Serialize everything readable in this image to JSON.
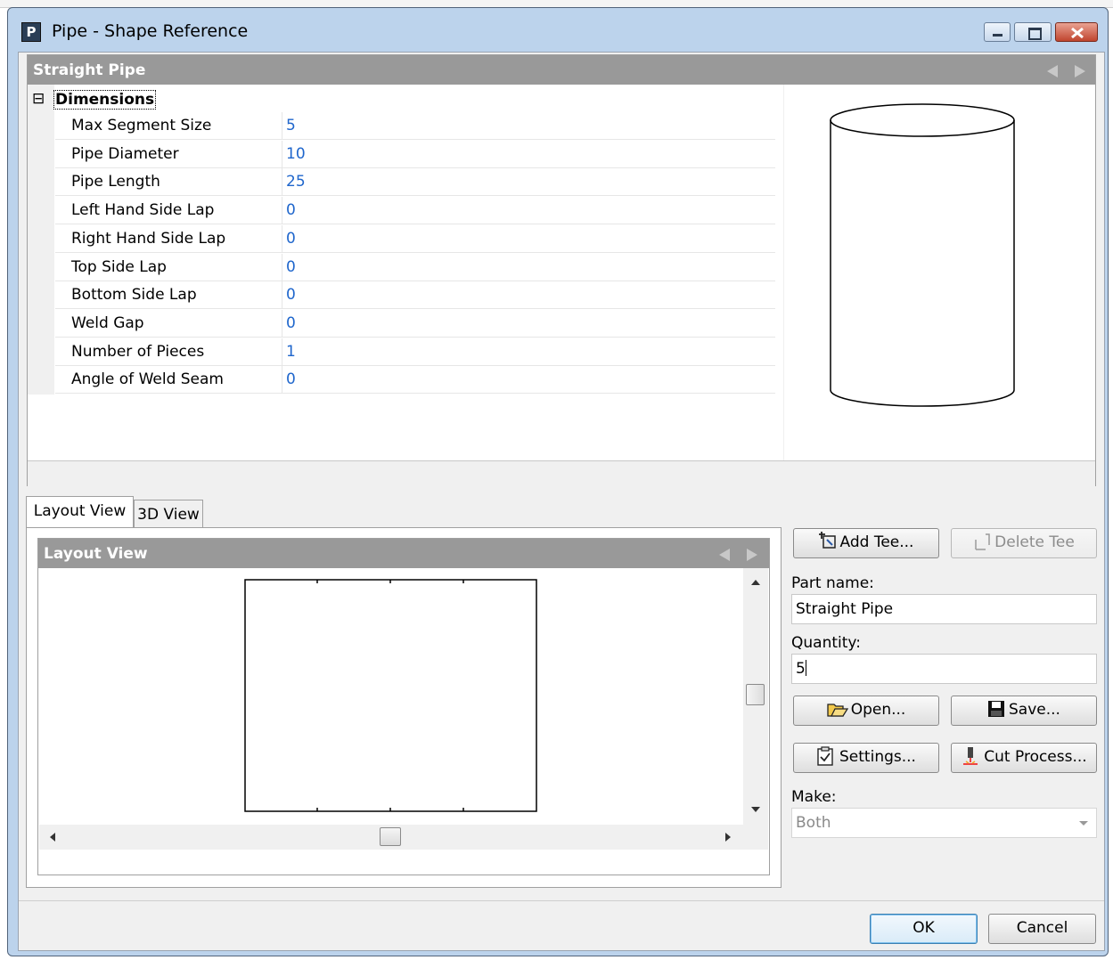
{
  "window": {
    "title": "Pipe - Shape Reference",
    "app_icon": "P"
  },
  "property_panel": {
    "header": "Straight Pipe",
    "group_toggle": "⊟",
    "group_label": "Dimensions",
    "rows": [
      {
        "name": "Max Segment Size",
        "value": "5"
      },
      {
        "name": "Pipe Diameter",
        "value": "10"
      },
      {
        "name": "Pipe Length",
        "value": "25"
      },
      {
        "name": "Left Hand Side Lap",
        "value": "0"
      },
      {
        "name": "Right Hand Side Lap",
        "value": "0"
      },
      {
        "name": "Top Side Lap",
        "value": "0"
      },
      {
        "name": "Bottom Side Lap",
        "value": "0"
      },
      {
        "name": "Weld Gap",
        "value": "0"
      },
      {
        "name": "Number of Pieces",
        "value": "1"
      },
      {
        "name": "Angle of Weld Seam",
        "value": "0"
      }
    ]
  },
  "tabs": {
    "layout": "Layout View",
    "view3d": "3D View"
  },
  "layout_panel": {
    "header": "Layout View"
  },
  "actions": {
    "add_tee": "Add Tee...",
    "delete_tee": "Delete Tee",
    "part_name_label": "Part name:",
    "part_name_value": "Straight Pipe",
    "quantity_label": "Quantity:",
    "quantity_value": "5",
    "open": "Open...",
    "save": "Save...",
    "settings": "Settings...",
    "cut_process": "Cut Process...",
    "make_label": "Make:",
    "make_value": "Both"
  },
  "footer": {
    "ok": "OK",
    "cancel": "Cancel"
  }
}
